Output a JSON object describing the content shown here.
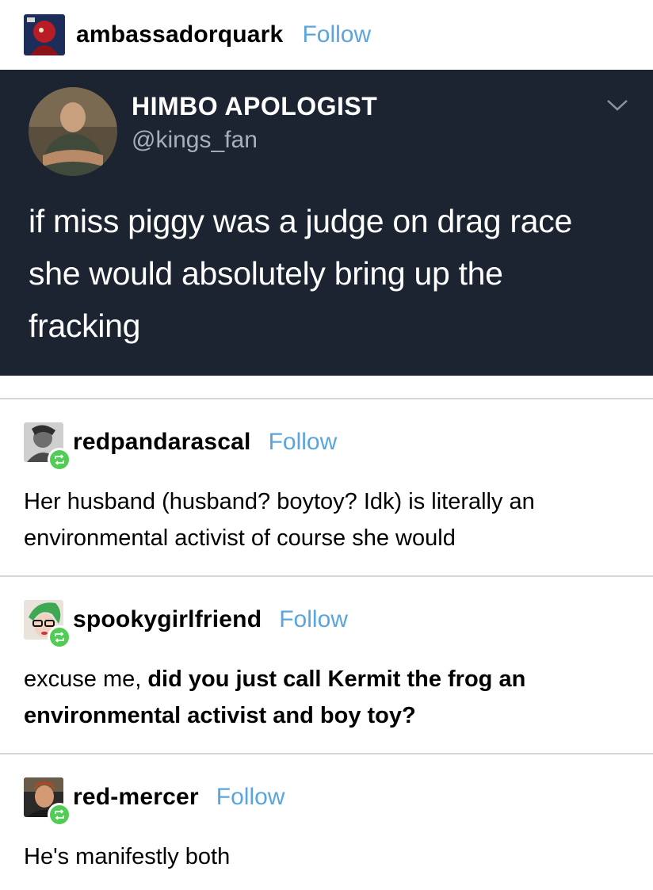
{
  "original_post": {
    "username": "ambassadorquark",
    "follow_label": "Follow"
  },
  "tweet": {
    "display_name": "HIMBO APOLOGIST",
    "handle": "@kings_fan",
    "text_lines": [
      "if miss piggy was a judge on drag race",
      "she would absolutely bring up the",
      "fracking"
    ]
  },
  "reblogs": [
    {
      "username": "redpandarascal",
      "follow_label": "Follow",
      "text_lines": [
        "Her husband (husband? boytoy? Idk) is literally an",
        "environmental activist of course she would"
      ]
    },
    {
      "username": "spookygirlfriend",
      "follow_label": "Follow",
      "text_prefix": "excuse me, ",
      "text_bold_1": "did you just call Kermit the frog an",
      "text_bold_2": "environmental activist and boy toy?"
    },
    {
      "username": "red-mercer",
      "follow_label": "Follow",
      "text_lines": [
        "He's manifestly both"
      ]
    }
  ],
  "colors": {
    "follow": "#5aa5de",
    "tweet_bg": "#1b2430",
    "reblog_badge": "#4fcd55"
  },
  "icons": {
    "reblog_badge": "reblog-icon",
    "tweet_menu": "chevron-down-icon"
  }
}
